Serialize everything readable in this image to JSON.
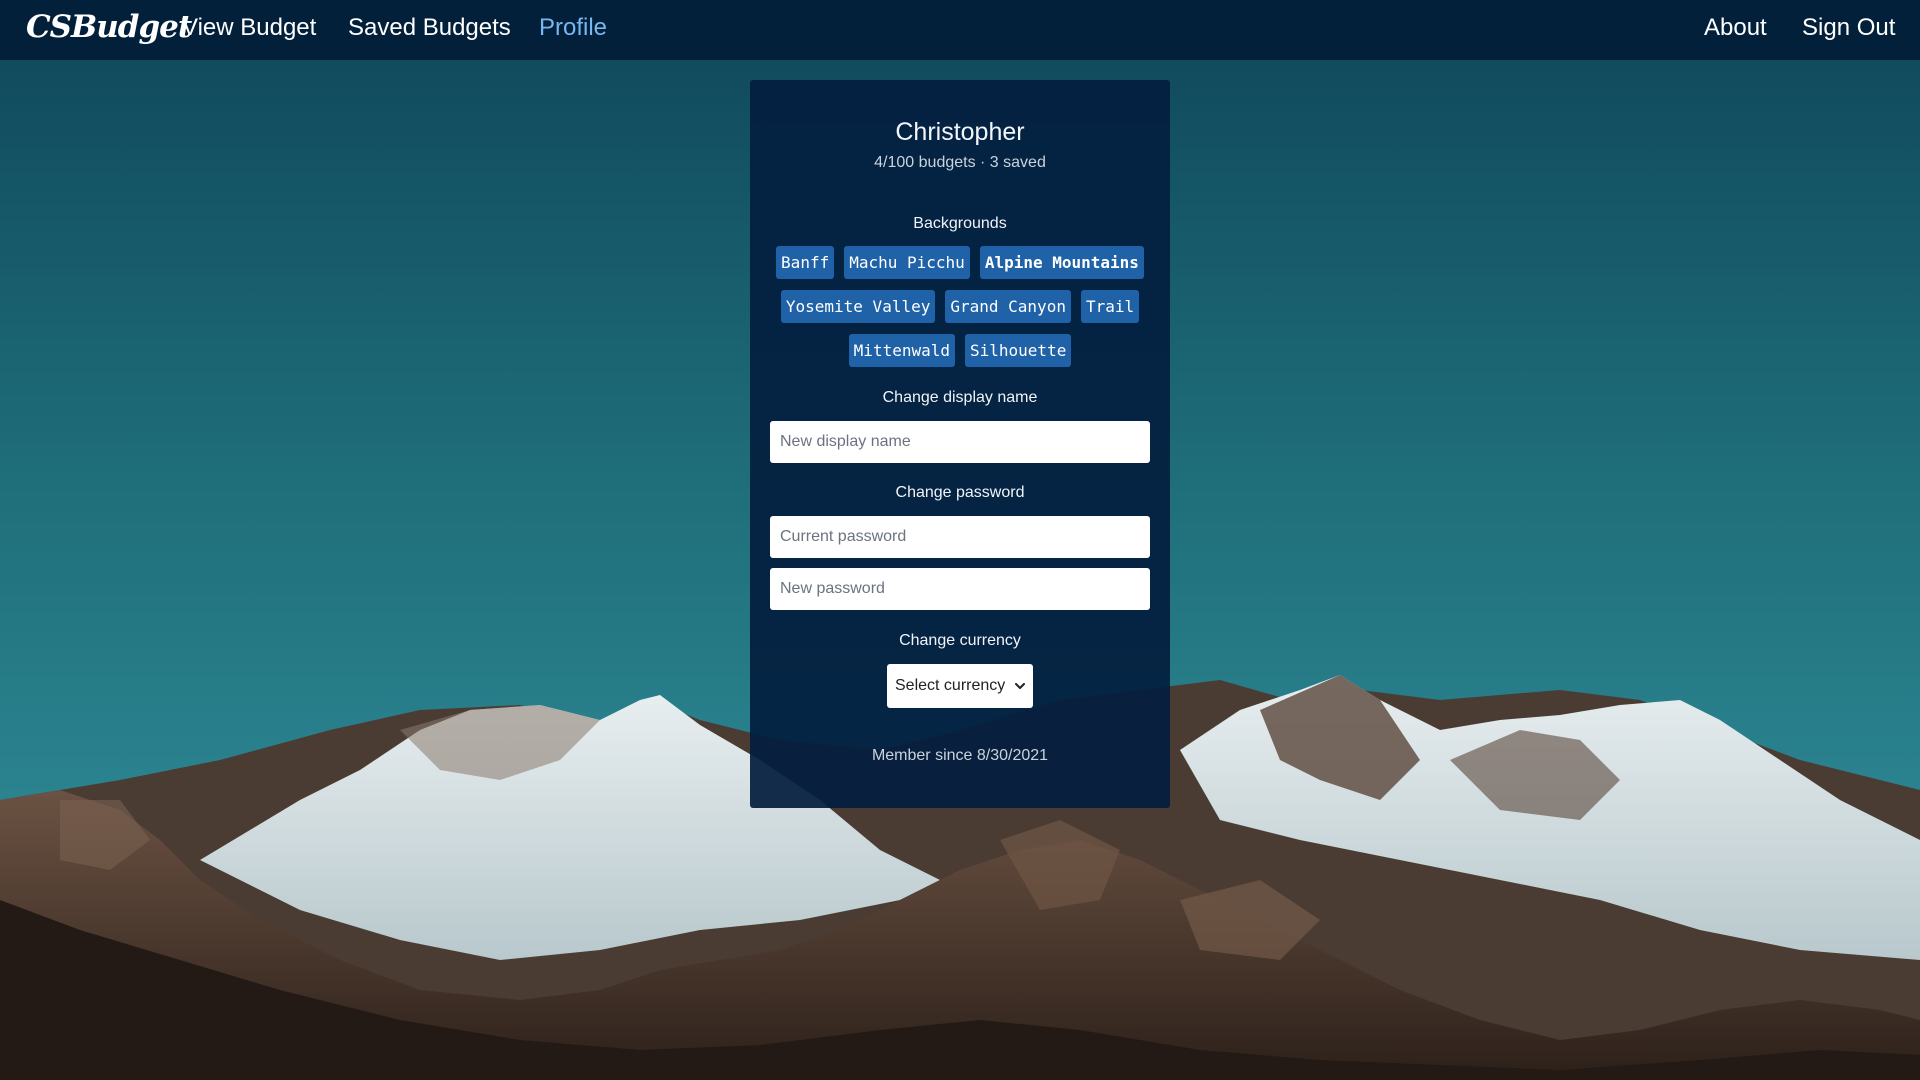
{
  "nav": {
    "brand": "CSBudget",
    "links": {
      "view_budget": "View Budget",
      "saved_budgets": "Saved Budgets",
      "profile": "Profile",
      "about": "About",
      "sign_out": "Sign Out"
    },
    "active": "Profile"
  },
  "profile": {
    "name": "Christopher",
    "stats": "4/100 budgets · 3 saved",
    "backgrounds_label": "Backgrounds",
    "backgrounds": {
      "banff": "Banff",
      "machu_picchu": "Machu Picchu",
      "alpine_mountains": "Alpine Mountains",
      "yosemite_valley": "Yosemite Valley",
      "grand_canyon": "Grand Canyon",
      "trail": "Trail",
      "mittenwald": "Mittenwald",
      "silhouette": "Silhouette"
    },
    "selected_background": "Alpine Mountains",
    "display_name_label": "Change display name",
    "display_name_placeholder": "New display name",
    "display_name_value": "",
    "password_label": "Change password",
    "current_password_placeholder": "Current password",
    "new_password_placeholder": "New password",
    "currency_label": "Change currency",
    "currency_selected": "Select currency",
    "member_since": "Member since 8/30/2021"
  },
  "colors": {
    "navbar": "#03203b",
    "card": "#031e3e",
    "tag": "#1f62a8",
    "active_link": "#79b6ef"
  },
  "icons": {
    "select_chevron": "chevron-down-icon"
  }
}
